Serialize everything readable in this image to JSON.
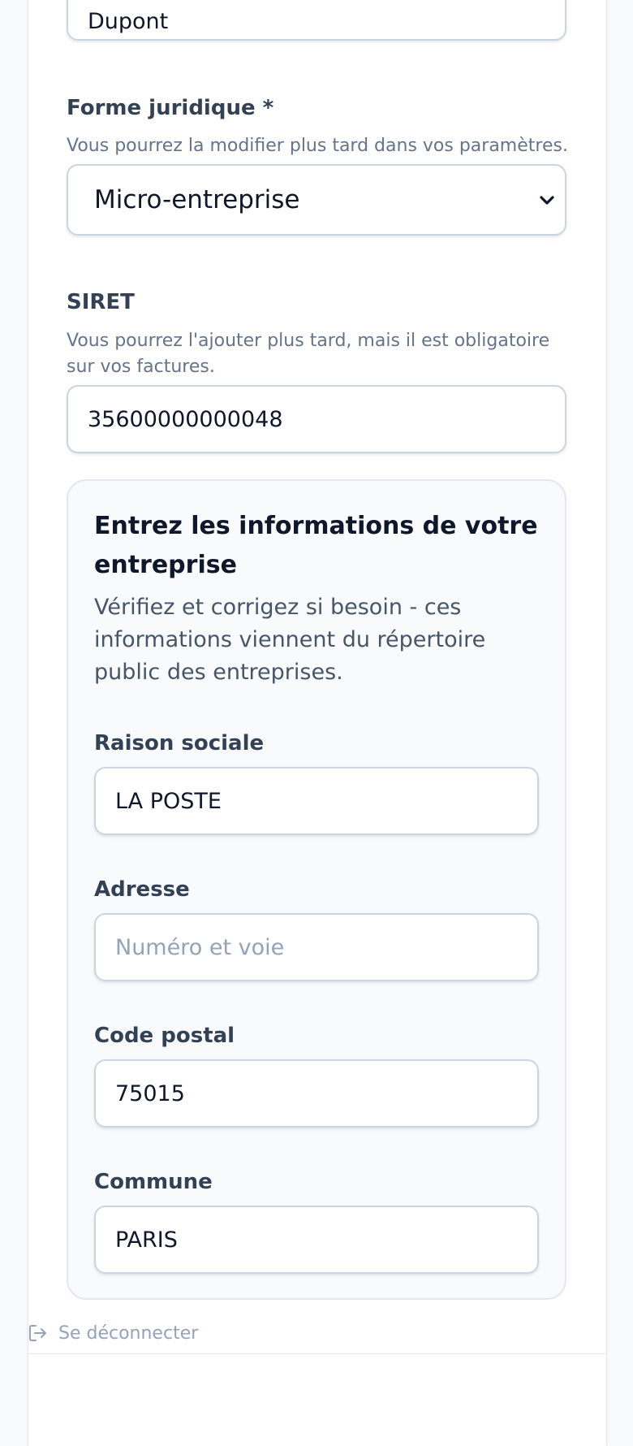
{
  "nom": {
    "value": "Dupont"
  },
  "forme_juridique": {
    "label": "Forme juridique *",
    "help": "Vous pourrez la modifier plus tard dans vos paramètres.",
    "selected": "Micro-entreprise"
  },
  "siret": {
    "label": "SIRET",
    "help": "Vous pourrez l'ajouter plus tard, mais il est obligatoire sur vos factures.",
    "value": "35600000000048"
  },
  "company_panel": {
    "title": "Entrez les informations de votre entreprise",
    "description": "Vérifiez et corrigez si besoin - ces informations viennent du répertoire public des entreprises.",
    "raison_sociale": {
      "label": "Raison sociale",
      "value": "LA POSTE"
    },
    "adresse": {
      "label": "Adresse",
      "placeholder": "Numéro et voie"
    },
    "code_postal": {
      "label": "Code postal",
      "value": "75015"
    },
    "commune": {
      "label": "Commune",
      "value": "PARIS"
    }
  },
  "logout": {
    "label": "Se déconnecter",
    "icon": "logout-icon"
  },
  "colors": {
    "page_background": "#f8fafc",
    "card_background": "#ffffff",
    "input_border": "#cbd5e1",
    "label_text": "#334155",
    "help_text": "#64748b",
    "placeholder_text": "#94a3b8",
    "panel_background": "#f8fafc"
  }
}
